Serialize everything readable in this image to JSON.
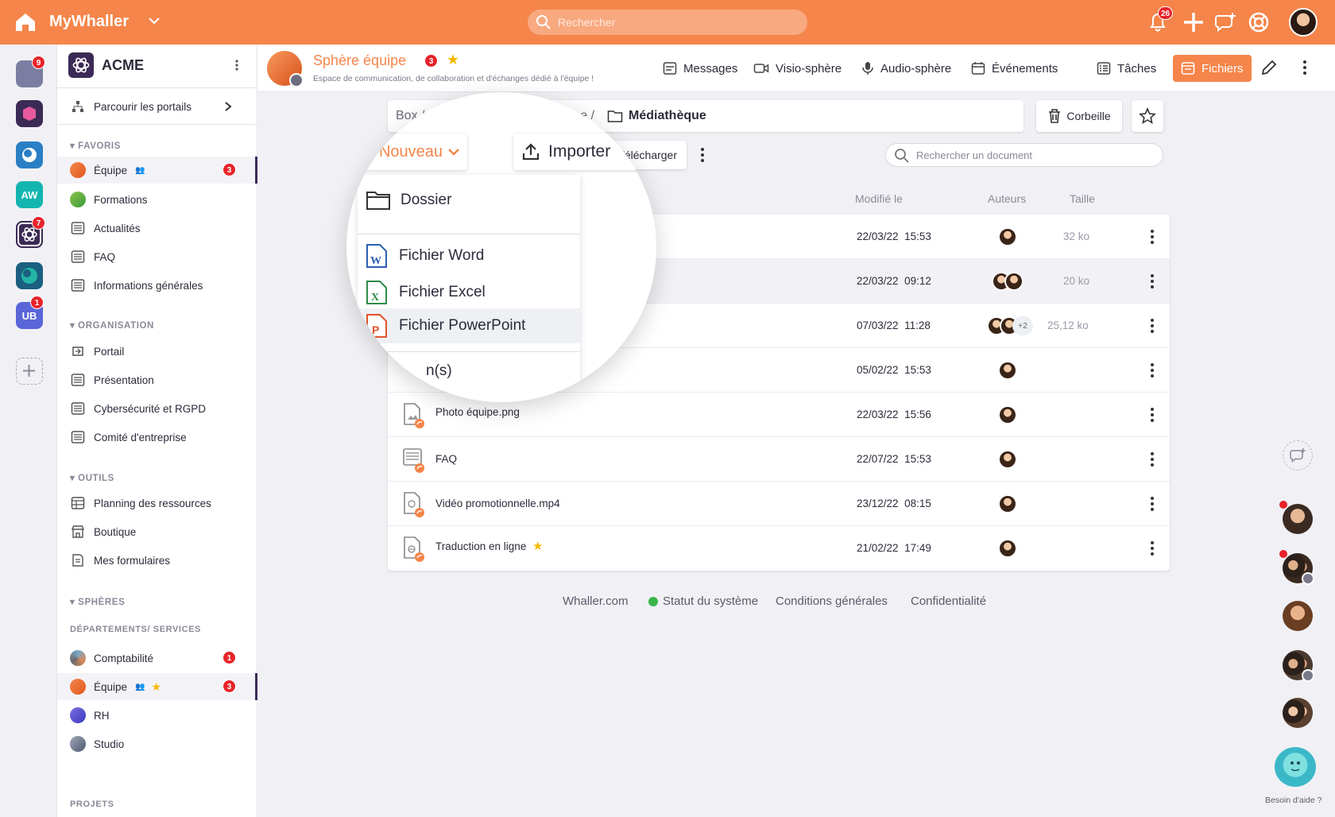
{
  "topbar": {
    "brand": "MyWhaller",
    "search_placeholder": "Rechercher",
    "notif_count": "26",
    "accent": "#f5854a"
  },
  "rail": {
    "badges": [
      "9",
      "7",
      "1"
    ],
    "aw_label": "AW",
    "ub_label": "UB"
  },
  "sidebar": {
    "org": "ACME",
    "browse": "Parcourir les portails",
    "sections": {
      "favoris": "FAVORIS",
      "organisation": "ORGANISATION",
      "outils": "OUTILS",
      "spheres": "SPHÈRES",
      "departements": "DÉPARTEMENTS/ SERVICES",
      "projets": "PROJETS"
    },
    "favoris": [
      {
        "label": "Équipe",
        "badge": "3"
      },
      {
        "label": "Formations"
      },
      {
        "label": "Actualités"
      },
      {
        "label": "FAQ"
      },
      {
        "label": "Informations générales"
      }
    ],
    "organisation": [
      "Portail",
      "Présentation",
      "Cybersécurité et RGPD",
      "Comité d'entreprise"
    ],
    "outils": [
      "Planning des ressources",
      "Boutique",
      "Mes formulaires"
    ],
    "departements": [
      {
        "label": "Comptabilité",
        "badge": "1"
      },
      {
        "label": "Équipe",
        "badge": "3"
      },
      {
        "label": "RH"
      },
      {
        "label": "Studio"
      }
    ]
  },
  "header": {
    "title": "Sphère équipe",
    "badge": "3",
    "subtitle": "Espace de communication, de collaboration et d'échanges dédié à l'équipe !",
    "nav": [
      "Messages",
      "Visio-sphère",
      "Audio-sphère",
      "Événements",
      "Tâches",
      "Fichiers"
    ]
  },
  "content": {
    "breadcrumb_start": "Box / D",
    "breadcrumb_mid": "quipe /",
    "breadcrumb_current": "Médiathèque",
    "trash": "Corbeille",
    "new": "Nouveau",
    "import": "Importer",
    "download": "Télécharger",
    "search_placeholder": "Rechercher un document",
    "columns": {
      "modified": "Modifié le",
      "authors": "Auteurs",
      "size": "Taille"
    },
    "rows": [
      {
        "name": "",
        "date": "22/03/22",
        "time": "15:53",
        "size": "32 ko",
        "extra": ""
      },
      {
        "name": "",
        "date": "22/03/22",
        "time": "09:12",
        "size": "20 ko",
        "extra": ""
      },
      {
        "name": "",
        "date": "07/03/22",
        "time": "11:28",
        "size": "25,12 ko",
        "extra": "+2"
      },
      {
        "name": "",
        "date": "05/02/22",
        "time": "15:53",
        "size": "",
        "extra": ""
      },
      {
        "name": "Photo équipe.png",
        "date": "22/03/22",
        "time": "15:56",
        "size": "",
        "extra": ""
      },
      {
        "name": "FAQ",
        "date": "22/07/22",
        "time": "15:53",
        "size": "",
        "extra": ""
      },
      {
        "name": "Vidéo promotionnelle.mp4",
        "date": "23/12/22",
        "time": "08:15",
        "size": "",
        "extra": ""
      },
      {
        "name": "Traduction en ligne",
        "date": "21/02/22",
        "time": "17:49",
        "size": "",
        "extra": ""
      }
    ]
  },
  "dropdown": {
    "folder": "Dossier",
    "word": "Fichier Word",
    "excel": "Fichier Excel",
    "powerpoint": "Fichier PowerPoint",
    "partial": "n(s)"
  },
  "footer": {
    "site": "Whaller.com",
    "status": "Statut du système",
    "terms": "Conditions générales",
    "privacy": "Confidentialité"
  },
  "help": "Besoin d'aide ?"
}
